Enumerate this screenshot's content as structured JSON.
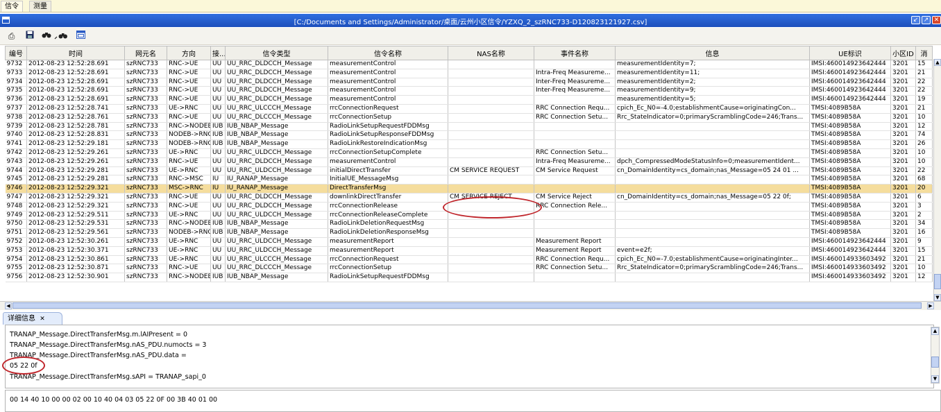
{
  "top_tabs": [
    "信令",
    "测量"
  ],
  "window": {
    "title": "[C:/Documents and Settings/Administrator/桌面/云州小区信令/YZXQ_2_szRNC733-D120823121927.csv]",
    "buttons": [
      "↙",
      "↗",
      "✕"
    ]
  },
  "toolbar": {
    "icons": [
      "print-icon",
      "save-icon",
      "find-icon",
      "find-next-icon",
      "window-icon"
    ]
  },
  "table": {
    "columns": [
      "编号",
      "时间",
      "网元名",
      "方向",
      "接...",
      "信令类型",
      "信令名称",
      "NAS名称",
      "事件名称",
      "信息",
      "UE标识",
      "小区ID",
      "消"
    ],
    "rows": [
      [
        "9732",
        "2012-08-23 12:52:28.691",
        "szRNC733",
        "RNC->UE",
        "UU",
        "UU_RRC_DLDCCH_Message",
        "measurementControl",
        "",
        "",
        "measurementIdentity=7;",
        "IMSI:460014923642444",
        "3201",
        "15"
      ],
      [
        "9733",
        "2012-08-23 12:52:28.691",
        "szRNC733",
        "RNC->UE",
        "UU",
        "UU_RRC_DLDCCH_Message",
        "measurementControl",
        "",
        "Intra-Freq Measureme...",
        "measurementIdentity=11;",
        "IMSI:460014923642444",
        "3201",
        "21"
      ],
      [
        "9734",
        "2012-08-23 12:52:28.691",
        "szRNC733",
        "RNC->UE",
        "UU",
        "UU_RRC_DLDCCH_Message",
        "measurementControl",
        "",
        "Inter-Freq Measureme...",
        "measurementIdentity=2;",
        "IMSI:460014923642444",
        "3201",
        "22"
      ],
      [
        "9735",
        "2012-08-23 12:52:28.691",
        "szRNC733",
        "RNC->UE",
        "UU",
        "UU_RRC_DLDCCH_Message",
        "measurementControl",
        "",
        "Inter-Freq Measureme...",
        "measurementIdentity=9;",
        "IMSI:460014923642444",
        "3201",
        "22"
      ],
      [
        "9736",
        "2012-08-23 12:52:28.691",
        "szRNC733",
        "RNC->UE",
        "UU",
        "UU_RRC_DLDCCH_Message",
        "measurementControl",
        "",
        "",
        "measurementIdentity=5;",
        "IMSI:460014923642444",
        "3201",
        "19"
      ],
      [
        "9737",
        "2012-08-23 12:52:28.741",
        "szRNC733",
        "UE->RNC",
        "UU",
        "UU_RRC_ULCCCH_Message",
        "rrcConnectionRequest",
        "",
        "RRC Connection Requ...",
        "cpich_Ec_N0=-4.0;establishmentCause=originatingCon...",
        "TMSI:4089B58A",
        "3201",
        "21"
      ],
      [
        "9738",
        "2012-08-23 12:52:28.761",
        "szRNC733",
        "RNC->UE",
        "UU",
        "UU_RRC_DLCCCH_Message",
        "rrcConnectionSetup",
        "",
        "RRC Connection Setu...",
        "Rrc_StateIndicator=0;primaryScramblingCode=246;Trans...",
        "TMSI:4089B58A",
        "3201",
        "10"
      ],
      [
        "9739",
        "2012-08-23 12:52:28.781",
        "szRNC733",
        "RNC->NODEB",
        "IUB",
        "IUB_NBAP_Message",
        "RadioLinkSetupRequestFDDMsg",
        "",
        "",
        "",
        "TMSI:4089B58A",
        "3201",
        "12"
      ],
      [
        "9740",
        "2012-08-23 12:52:28.831",
        "szRNC733",
        "NODEB->RNC",
        "IUB",
        "IUB_NBAP_Message",
        "RadioLinkSetupResponseFDDMsg",
        "",
        "",
        "",
        "TMSI:4089B58A",
        "3201",
        "74"
      ],
      [
        "9741",
        "2012-08-23 12:52:29.181",
        "szRNC733",
        "NODEB->RNC",
        "IUB",
        "IUB_NBAP_Message",
        "RadioLinkRestoreIndicationMsg",
        "",
        "",
        "",
        "TMSI:4089B58A",
        "3201",
        "26"
      ],
      [
        "9742",
        "2012-08-23 12:52:29.261",
        "szRNC733",
        "UE->RNC",
        "UU",
        "UU_RRC_ULDCCH_Message",
        "rrcConnectionSetupComplete",
        "",
        "RRC Connection Setu...",
        "",
        "TMSI:4089B58A",
        "3201",
        "10"
      ],
      [
        "9743",
        "2012-08-23 12:52:29.261",
        "szRNC733",
        "RNC->UE",
        "UU",
        "UU_RRC_DLDCCH_Message",
        "measurementControl",
        "",
        "Intra-Freq Measureme...",
        "dpch_CompressedModeStatusInfo=0;measurementIdent...",
        "TMSI:4089B58A",
        "3201",
        "10"
      ],
      [
        "9744",
        "2012-08-23 12:52:29.281",
        "szRNC733",
        "UE->RNC",
        "UU",
        "UU_RRC_ULDCCH_Message",
        "initialDirectTransfer",
        "CM SERVICE REQUEST",
        "CM Service Request",
        "cn_DomainIdentity=cs_domain;nas_Message=05 24 01 ...",
        "TMSI:4089B58A",
        "3201",
        "22"
      ],
      [
        "9745",
        "2012-08-23 12:52:29.281",
        "szRNC733",
        "RNC->MSC",
        "IU",
        "IU_RANAP_Message",
        "InitialUE_MessageMsg",
        "",
        "",
        "",
        "TMSI:4089B58A",
        "3201",
        "68"
      ],
      [
        "9746",
        "2012-08-23 12:52:29.321",
        "szRNC733",
        "MSC->RNC",
        "IU",
        "IU_RANAP_Message",
        "DirectTransferMsg",
        "",
        "",
        "",
        "TMSI:4089B58A",
        "3201",
        "20"
      ],
      [
        "9747",
        "2012-08-23 12:52:29.321",
        "szRNC733",
        "RNC->UE",
        "UU",
        "UU_RRC_DLDCCH_Message",
        "downlinkDirectTransfer",
        "CM SERVICE REJECT",
        "CM Service Reject",
        "cn_DomainIdentity=cs_domain;nas_Message=05 22 0f;",
        "TMSI:4089B58A",
        "3201",
        "6"
      ],
      [
        "9748",
        "2012-08-23 12:52:29.321",
        "szRNC733",
        "RNC->UE",
        "UU",
        "UU_RRC_DLDCCH_Message",
        "rrcConnectionRelease",
        "",
        "RRC Connection Rele...",
        "",
        "TMSI:4089B58A",
        "3201",
        "3"
      ],
      [
        "9749",
        "2012-08-23 12:52:29.511",
        "szRNC733",
        "UE->RNC",
        "UU",
        "UU_RRC_ULDCCH_Message",
        "rrcConnectionReleaseComplete",
        "",
        "",
        "",
        "TMSI:4089B58A",
        "3201",
        "2"
      ],
      [
        "9750",
        "2012-08-23 12:52:29.531",
        "szRNC733",
        "RNC->NODEB",
        "IUB",
        "IUB_NBAP_Message",
        "RadioLinkDeletionRequestMsg",
        "",
        "",
        "",
        "TMSI:4089B58A",
        "3201",
        "34"
      ],
      [
        "9751",
        "2012-08-23 12:52:29.561",
        "szRNC733",
        "NODEB->RNC",
        "IUB",
        "IUB_NBAP_Message",
        "RadioLinkDeletionResponseMsg",
        "",
        "",
        "",
        "TMSI:4089B58A",
        "3201",
        "16"
      ],
      [
        "9752",
        "2012-08-23 12:52:30.261",
        "szRNC733",
        "UE->RNC",
        "UU",
        "UU_RRC_ULDCCH_Message",
        "measurementReport",
        "",
        "Measurement Report",
        "",
        "IMSI:460014923642444",
        "3201",
        "9"
      ],
      [
        "9753",
        "2012-08-23 12:52:30.371",
        "szRNC733",
        "UE->RNC",
        "UU",
        "UU_RRC_ULDCCH_Message",
        "measurementReport",
        "",
        "Measurement Report",
        "event=e2f;",
        "IMSI:460014923642444",
        "3201",
        "15"
      ],
      [
        "9754",
        "2012-08-23 12:52:30.861",
        "szRNC733",
        "UE->RNC",
        "UU",
        "UU_RRC_ULCCCH_Message",
        "rrcConnectionRequest",
        "",
        "RRC Connection Requ...",
        "cpich_Ec_N0=-7.0;establishmentCause=originatingInter...",
        "IMSI:460014933603492",
        "3201",
        "21"
      ],
      [
        "9755",
        "2012-08-23 12:52:30.871",
        "szRNC733",
        "RNC->UE",
        "UU",
        "UU_RRC_DLCCCH_Message",
        "rrcConnectionSetup",
        "",
        "RRC Connection Setu...",
        "Rrc_StateIndicator=0;primaryScramblingCode=246;Trans...",
        "IMSI:460014933603492",
        "3201",
        "10"
      ],
      [
        "9756",
        "2012-08-23 12:52:30.901",
        "szRNC733",
        "RNC->NODEB",
        "IUB",
        "IUB_NBAP_Message",
        "RadioLinkSetupRequestFDDMsg",
        "",
        "",
        "",
        "IMSI:460014933603492",
        "3201",
        "12"
      ]
    ]
  },
  "details": {
    "tab_label": "详细信息",
    "lines": [
      "TRANAP_Message.DirectTransferMsg.m.lAIPresent = 0",
      "TRANAP_Message.DirectTransferMsg.nAS_PDU.numocts = 3",
      "TRANAP_Message.DirectTransferMsg.nAS_PDU.data =",
      "05 22 0f",
      "TRANAP_Message.DirectTransferMsg.sAPI = TRANAP_sapi_0"
    ],
    "hex": "00 14 40 10 00 00 02 00 10 40 04 03 05 22 0F 00 3B 40 01 00"
  },
  "selected_row": "9746",
  "colors": {
    "selected_row": "#f5dd9d",
    "title_bar": "#2f6fe0",
    "annotation_ring": "#c0262c"
  }
}
